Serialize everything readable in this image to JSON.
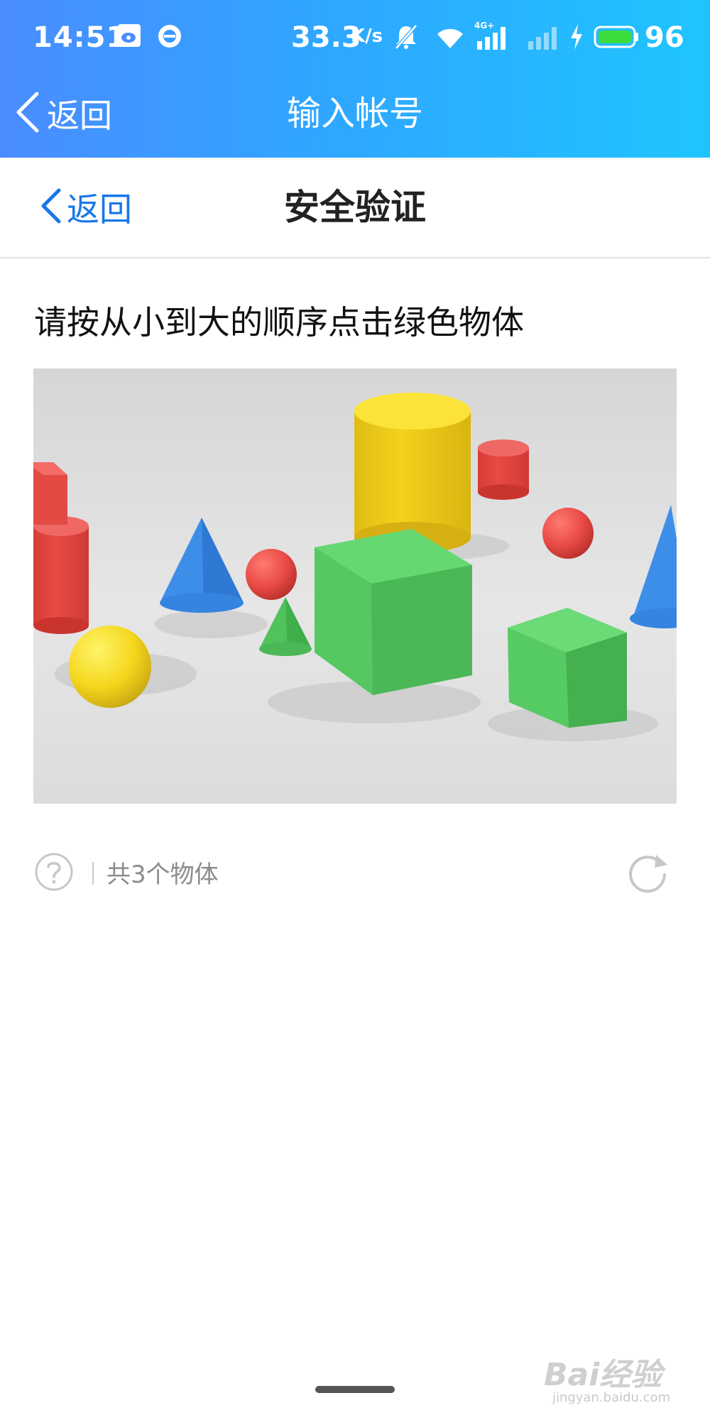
{
  "status_bar": {
    "time": "14:51",
    "net_speed": "33.3",
    "net_speed_unit": "K/s",
    "network_tag": "4G+",
    "battery": "96",
    "icons": [
      "weibo-icon",
      "chat-bubble-icon",
      "mute-bell-icon",
      "wifi-icon",
      "signal-4g-icon",
      "signal-weak-icon",
      "charging-icon",
      "battery-icon"
    ]
  },
  "outer_nav": {
    "back_label": "返回",
    "title": "输入帐号"
  },
  "inner_nav": {
    "back_label": "返回",
    "title": "安全验证"
  },
  "captcha": {
    "instruction": "请按从小到大的顺序点击绿色物体",
    "object_count_text": "共3个物体",
    "help_icon": "question-circle-icon",
    "refresh_icon": "refresh-icon",
    "shapes": [
      "red-cylinder",
      "blue-cone",
      "red-sphere",
      "green-cone",
      "yellow-cylinder",
      "red-small-cylinder",
      "green-large-cube",
      "red-sphere-right",
      "blue-cone-right",
      "green-small-cube",
      "yellow-sphere"
    ]
  },
  "watermark": {
    "main": "Bai经验",
    "sub": "jingyan.baidu.com"
  },
  "colors": {
    "header_start": "#4a8cff",
    "header_end": "#1fc4ff",
    "link_blue": "#1877e8",
    "shape_green": "#4cc15a",
    "shape_red": "#e84a45",
    "shape_blue": "#3d8ee8",
    "shape_yellow": "#f2d21c"
  }
}
